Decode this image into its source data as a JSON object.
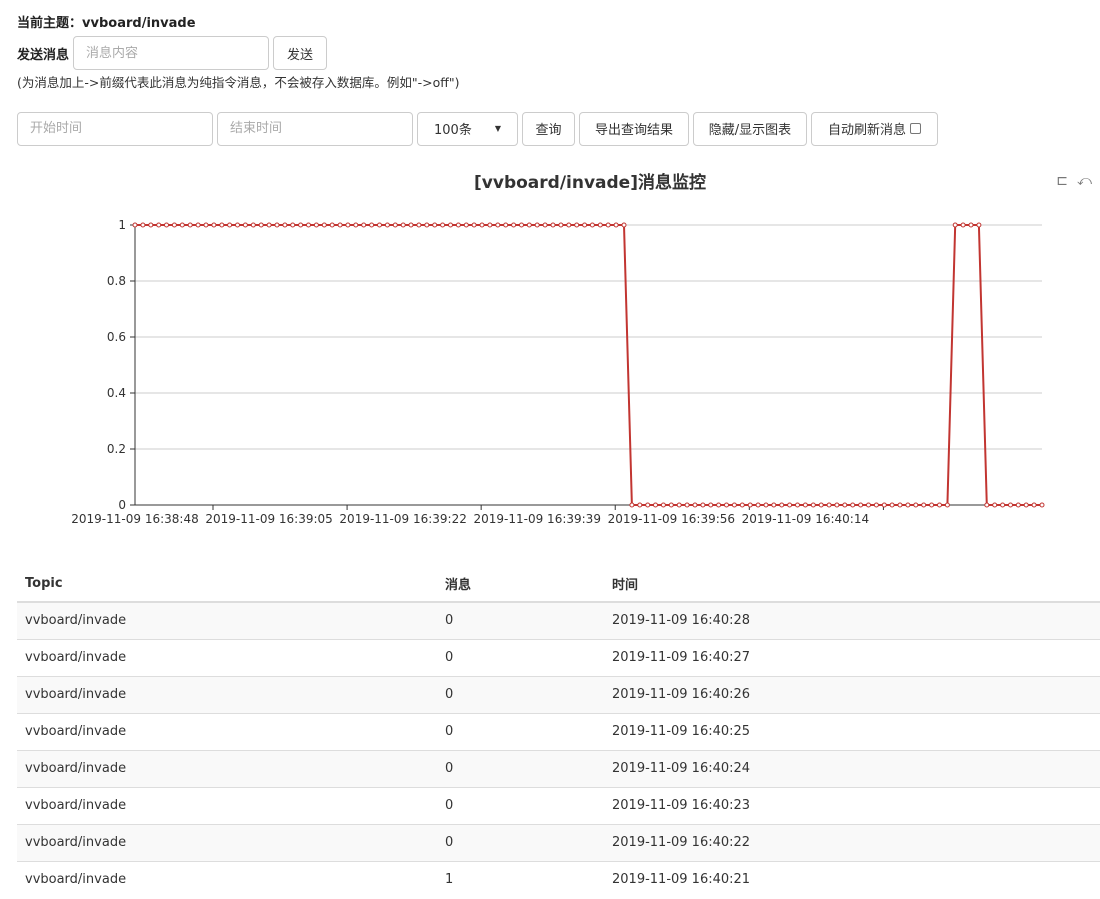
{
  "topic": {
    "label": "当前主题：",
    "value": "vvboard/invade"
  },
  "send": {
    "label": "发送消息",
    "placeholder": "消息内容",
    "button": "发送"
  },
  "hint": "(为消息加上->前缀代表此消息为纯指令消息，不会被存入数据库。例如\"->off\")",
  "query": {
    "start_placeholder": "开始时间",
    "end_placeholder": "结束时间",
    "limit_selected": "100条",
    "query_button": "查询",
    "export_button": "导出查询结果",
    "toggle_chart_button": "隐藏/显示图表",
    "auto_refresh_label": "自动刷新消息"
  },
  "chart_data": {
    "type": "line",
    "title": "[vvboard/invade]消息监控",
    "xlabel": "",
    "ylabel": "",
    "ylim": [
      0,
      1
    ],
    "y_ticks": [
      "0",
      "0.2",
      "0.4",
      "0.6",
      "0.8",
      "1"
    ],
    "x_tick_labels": [
      "2019-11-09 16:38:48",
      "2019-11-09 16:39:05",
      "2019-11-09 16:39:22",
      "2019-11-09 16:39:39",
      "2019-11-09 16:39:56",
      "2019-11-09 16:40:14"
    ],
    "grid": true,
    "line_color": "#c23531",
    "x_start": "2019-11-09 16:38:48",
    "x_end": "2019-11-09 16:40:28",
    "values": [
      1,
      1,
      1,
      1,
      1,
      1,
      1,
      1,
      1,
      1,
      1,
      1,
      1,
      1,
      1,
      1,
      1,
      1,
      1,
      1,
      1,
      1,
      1,
      1,
      1,
      1,
      1,
      1,
      1,
      1,
      1,
      1,
      1,
      1,
      1,
      1,
      1,
      1,
      1,
      1,
      1,
      1,
      1,
      1,
      1,
      1,
      1,
      1,
      1,
      1,
      1,
      1,
      1,
      1,
      1,
      1,
      1,
      1,
      1,
      1,
      1,
      1,
      1,
      0,
      0,
      0,
      0,
      0,
      0,
      0,
      0,
      0,
      0,
      0,
      0,
      0,
      0,
      0,
      0,
      0,
      0,
      0,
      0,
      0,
      0,
      0,
      0,
      0,
      0,
      0,
      0,
      0,
      0,
      0,
      0,
      0,
      0,
      0,
      0,
      0,
      0,
      0,
      0,
      0,
      1,
      1,
      1,
      1,
      0,
      0,
      0,
      0,
      0,
      0,
      0,
      0
    ]
  },
  "table": {
    "headers": [
      "Topic",
      "消息",
      "时间"
    ],
    "rows": [
      [
        "vvboard/invade",
        "0",
        "2019-11-09 16:40:28"
      ],
      [
        "vvboard/invade",
        "0",
        "2019-11-09 16:40:27"
      ],
      [
        "vvboard/invade",
        "0",
        "2019-11-09 16:40:26"
      ],
      [
        "vvboard/invade",
        "0",
        "2019-11-09 16:40:25"
      ],
      [
        "vvboard/invade",
        "0",
        "2019-11-09 16:40:24"
      ],
      [
        "vvboard/invade",
        "0",
        "2019-11-09 16:40:23"
      ],
      [
        "vvboard/invade",
        "0",
        "2019-11-09 16:40:22"
      ],
      [
        "vvboard/invade",
        "1",
        "2019-11-09 16:40:21"
      ]
    ]
  }
}
